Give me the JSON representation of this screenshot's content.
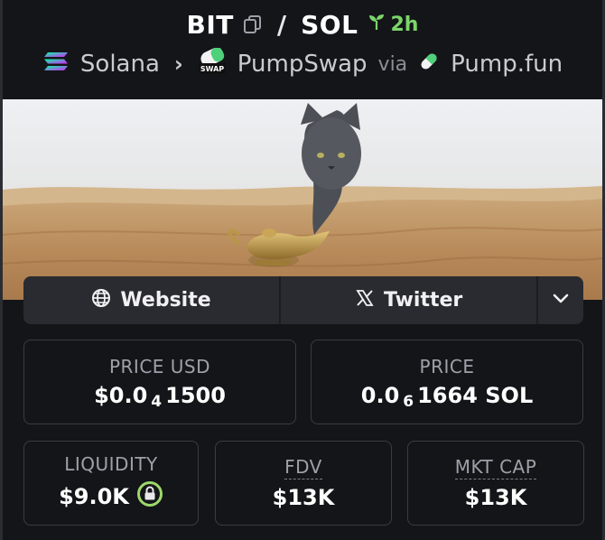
{
  "header": {
    "base_token": "BIT",
    "separator": "/",
    "quote_token": "SOL",
    "age": "2h"
  },
  "breadcrumb": {
    "chain": "Solana",
    "dex": "PumpSwap",
    "dex_badge": "SWAP",
    "via_label": "via",
    "launchpad": "Pump.fun"
  },
  "links": {
    "website_label": "Website",
    "twitter_label": "Twitter"
  },
  "stats": {
    "price_usd": {
      "label": "PRICE USD",
      "prefix": "$0.0",
      "zeros": "4",
      "digits": "1500"
    },
    "price_native": {
      "label": "PRICE",
      "prefix": "0.0",
      "zeros": "6",
      "digits": "1664 SOL"
    },
    "liquidity": {
      "label": "LIQUIDITY",
      "value": "$9.0K"
    },
    "fdv": {
      "label": "FDV",
      "value": "$13K"
    },
    "mkt_cap": {
      "label": "MKT CAP",
      "value": "$13K"
    }
  },
  "colors": {
    "background": "#141519",
    "accent_green": "#7bd56a",
    "card_border": "#3a3c43",
    "button_bg": "#2a2b30",
    "lock_ring": "#9dd86a"
  },
  "icons": [
    "copy-icon",
    "sprout-icon",
    "solana-icon",
    "chevron-right-icon",
    "pumpswap-icon",
    "pill-icon",
    "globe-icon",
    "x-icon",
    "chevron-down-icon",
    "lock-icon"
  ]
}
